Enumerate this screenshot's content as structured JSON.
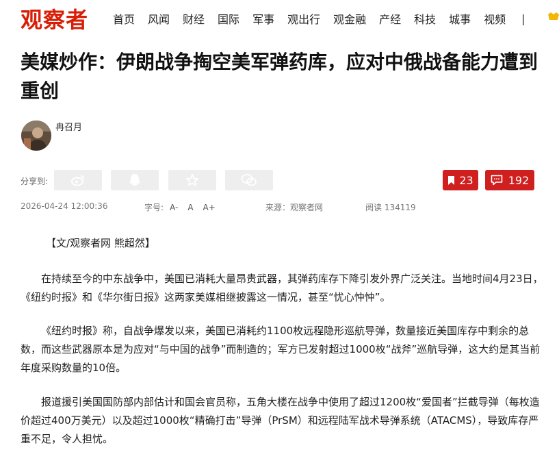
{
  "site": {
    "logo": "观察者"
  },
  "nav": {
    "items": [
      "首页",
      "风闻",
      "财经",
      "国际",
      "军事",
      "观出行",
      "观金融",
      "产经",
      "科技",
      "城事",
      "视频"
    ],
    "separator": "|"
  },
  "article": {
    "title": "美媒炒作：伊朗战争掏空美军弹药库，应对中俄战备能力遭到重创",
    "author": "冉召月",
    "share_label": "分享到:",
    "share_buttons": [
      "weibo-icon",
      "qq-icon",
      "star-icon",
      "wechat-icon"
    ],
    "bookmark_count": "23",
    "comment_count": "192",
    "date": "2026-04-24 12:00:36",
    "font_size_label": "字号:",
    "font_sizes": [
      "A-",
      "A",
      "A+"
    ],
    "source": "来源：观察者网",
    "views": "阅读 134119",
    "byline": "【文/观察者网 熊超然】",
    "paragraphs": [
      "在持续至今的中东战争中，美国已消耗大量昂贵武器，其弹药库存下降引发外界广泛关注。当地时间4月23日，《纽约时报》和《华尔街日报》这两家美媒相继披露这一情况，甚至“忧心忡忡”。",
      "《纽约时报》称，自战争爆发以来，美国已消耗约1100枚远程隐形巡航导弹，数量接近美国库存中剩余的总数，而这些武器原本是为应对“与中国的战争”而制造的；军方已发射超过1000枚“战斧”巡航导弹，这大约是其当前年度采购数量的10倍。",
      "报道援引美国国防部内部估计和国会官员称，五角大楼在战争中使用了超过1200枚“爱国者”拦截导弹（每枚造价超过400万美元）以及超过1000枚“精确打击”导弹（PrSM）和远程陆军战术导弹系统（ATACMS），导致库存严重不足，令人担忧。"
    ]
  },
  "colors": {
    "brand": "#d81e06",
    "stat_button": "#d01f1f",
    "share_bg": "#eeeeee"
  }
}
